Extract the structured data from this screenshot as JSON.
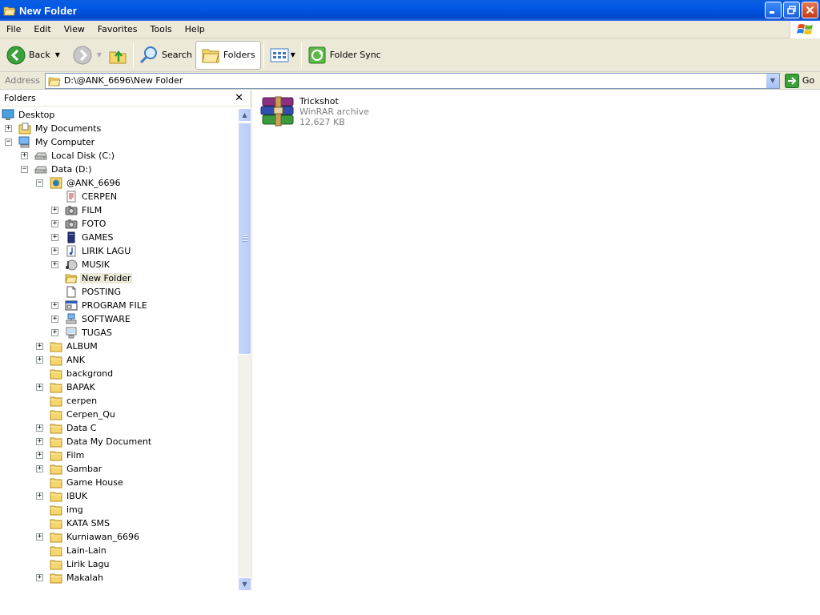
{
  "window": {
    "title": "New Folder"
  },
  "menu": [
    "File",
    "Edit",
    "View",
    "Favorites",
    "Tools",
    "Help"
  ],
  "toolbar": {
    "back_label": "Back",
    "search_label": "Search",
    "folders_label": "Folders",
    "folder_sync_label": "Folder Sync"
  },
  "address": {
    "label": "Address",
    "value": "D:\\@ANK_6696\\New Folder",
    "go_label": "Go"
  },
  "folders_pane": {
    "title": "Folders",
    "close_glyph": "✕",
    "tree": [
      {
        "label": "Desktop",
        "level": 0,
        "expander": "none",
        "icon": "desktop-icon"
      },
      {
        "label": "My Documents",
        "level": 1,
        "expander": "+",
        "icon": "my-documents-icon"
      },
      {
        "label": "My Computer",
        "level": 1,
        "expander": "-",
        "icon": "my-computer-icon"
      },
      {
        "label": "Local Disk (C:)",
        "level": 2,
        "expander": "+",
        "icon": "drive-icon"
      },
      {
        "label": "Data (D:)",
        "level": 2,
        "expander": "-",
        "icon": "drive-icon"
      },
      {
        "label": "@ANK_6696",
        "level": 3,
        "expander": "-",
        "icon": "globe-folder-icon"
      },
      {
        "label": "CERPEN",
        "level": 4,
        "expander": "none",
        "icon": "document-folder-icon"
      },
      {
        "label": "FILM",
        "level": 4,
        "expander": "+",
        "icon": "camera-folder-icon"
      },
      {
        "label": "FOTO",
        "level": 4,
        "expander": "+",
        "icon": "camera-folder-icon"
      },
      {
        "label": "GAMES",
        "level": 4,
        "expander": "+",
        "icon": "book-folder-icon"
      },
      {
        "label": "LIRIK LAGU",
        "level": 4,
        "expander": "+",
        "icon": "music-note-icon"
      },
      {
        "label": "MUSIK",
        "level": 4,
        "expander": "+",
        "icon": "music-folder-icon"
      },
      {
        "label": "New Folder",
        "level": 4,
        "expander": "none",
        "icon": "open-folder-icon",
        "selected": true
      },
      {
        "label": "POSTING",
        "level": 4,
        "expander": "none",
        "icon": "page-icon"
      },
      {
        "label": "PROGRAM FILE",
        "level": 4,
        "expander": "+",
        "icon": "program-folder-icon"
      },
      {
        "label": "SOFTWARE",
        "level": 4,
        "expander": "+",
        "icon": "network-folder-icon"
      },
      {
        "label": "TUGAS",
        "level": 4,
        "expander": "+",
        "icon": "computer-folder-icon"
      },
      {
        "label": "ALBUM",
        "level": 3,
        "expander": "+",
        "icon": "folder-icon"
      },
      {
        "label": "ANK",
        "level": 3,
        "expander": "+",
        "icon": "folder-icon"
      },
      {
        "label": "backgrond",
        "level": 3,
        "expander": "none",
        "icon": "folder-icon"
      },
      {
        "label": "BAPAK",
        "level": 3,
        "expander": "+",
        "icon": "folder-icon"
      },
      {
        "label": "cerpen",
        "level": 3,
        "expander": "none",
        "icon": "folder-icon"
      },
      {
        "label": "Cerpen_Qu",
        "level": 3,
        "expander": "none",
        "icon": "folder-icon"
      },
      {
        "label": "Data C",
        "level": 3,
        "expander": "+",
        "icon": "folder-icon"
      },
      {
        "label": "Data My Document",
        "level": 3,
        "expander": "+",
        "icon": "folder-icon"
      },
      {
        "label": "Film",
        "level": 3,
        "expander": "+",
        "icon": "folder-icon"
      },
      {
        "label": "Gambar",
        "level": 3,
        "expander": "+",
        "icon": "folder-icon"
      },
      {
        "label": "Game House",
        "level": 3,
        "expander": "none",
        "icon": "folder-icon"
      },
      {
        "label": "IBUK",
        "level": 3,
        "expander": "+",
        "icon": "folder-icon"
      },
      {
        "label": "img",
        "level": 3,
        "expander": "none",
        "icon": "folder-icon"
      },
      {
        "label": "KATA SMS",
        "level": 3,
        "expander": "none",
        "icon": "folder-icon"
      },
      {
        "label": "Kurniawan_6696",
        "level": 3,
        "expander": "+",
        "icon": "folder-icon"
      },
      {
        "label": "Lain-Lain",
        "level": 3,
        "expander": "none",
        "icon": "folder-icon"
      },
      {
        "label": "Lirik Lagu",
        "level": 3,
        "expander": "none",
        "icon": "folder-icon"
      },
      {
        "label": "Makalah",
        "level": 3,
        "expander": "+",
        "icon": "folder-icon"
      }
    ]
  },
  "content": {
    "files": [
      {
        "name": "Trickshot",
        "type": "WinRAR archive",
        "size": "12,627 KB",
        "icon": "winrar-archive-icon"
      }
    ]
  },
  "colors": {
    "titlebar": "#0058e6",
    "chrome": "#ece9d8",
    "folder_yellow": "#f5d76e",
    "selection": "#ece9d8"
  }
}
